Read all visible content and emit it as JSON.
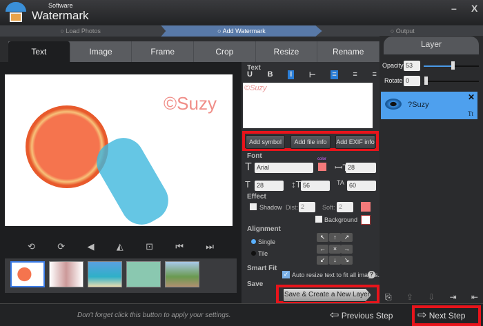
{
  "app": {
    "logo_sub": "Software",
    "logo_main": "Watermark",
    "minimize": "–",
    "close": "X"
  },
  "steps": [
    "Load Photos",
    "Add Watermark",
    "Output"
  ],
  "tabs": [
    "Text",
    "Image",
    "Frame",
    "Crop",
    "Resize",
    "Rename"
  ],
  "photo": {
    "watermark_text": "©Suzy"
  },
  "text_section": {
    "title": "Text",
    "format_buttons": [
      "U",
      "B",
      "I",
      "⊢",
      "≡",
      "≡",
      "≡"
    ],
    "content": "©Suzy"
  },
  "insert_buttons": [
    "Add symbol",
    "Add file info",
    "Add EXIF info"
  ],
  "font": {
    "title": "Font",
    "family": "Arial",
    "color_label": "color",
    "color": "#f47a7a",
    "size": "28",
    "width": "28",
    "height": "56",
    "spacing": "60"
  },
  "effect": {
    "title": "Effect",
    "shadow": "Shadow",
    "dist_label": "Dist:",
    "dist": "2",
    "soft_label": "Soft:",
    "soft": "2",
    "background": "Background",
    "shadow_color": "#f47a7a",
    "background_color": "#ffffff"
  },
  "alignment": {
    "title": "Alignment",
    "single": "Single",
    "tile": "Tile",
    "grid": [
      "↖",
      "↑",
      "↗",
      "←",
      "×",
      "→",
      "↙",
      "↓",
      "↘"
    ]
  },
  "smart_fit": {
    "title": "Smart Fit",
    "label": "Auto resize text to fit all images.",
    "checked": true,
    "help": "?"
  },
  "save": {
    "title": "Save",
    "button": "Save & Create a New Layer"
  },
  "layer": {
    "title": "Layer",
    "opacity_label": "Opacity",
    "opacity": "53",
    "rotate_label": "Rotate",
    "rotate": "0",
    "item_name": "?Suzy",
    "item_close": "✕",
    "item_type": "Tt"
  },
  "bottom": {
    "hint": "Don't forget click this button to apply your settings.",
    "previous": "Previous Step",
    "next": "Next Step"
  }
}
